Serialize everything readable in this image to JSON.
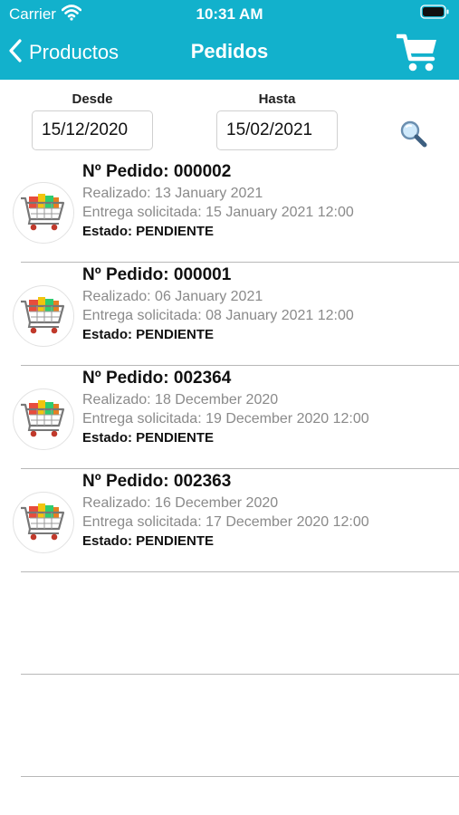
{
  "status_bar": {
    "carrier": "Carrier",
    "time": "10:31 AM"
  },
  "nav": {
    "back_label": "Productos",
    "title": "Pedidos"
  },
  "filters": {
    "from_label": "Desde",
    "from_value": "15/12/2020",
    "to_label": "Hasta",
    "to_value": "15/02/2021"
  },
  "orders": [
    {
      "number": "Nº Pedido: 000002",
      "placed": "Realizado: 13 January 2021",
      "delivery": "Entrega solicitada: 15 January 2021 12:00",
      "status": "Estado: PENDIENTE"
    },
    {
      "number": "Nº Pedido: 000001",
      "placed": "Realizado: 06 January 2021",
      "delivery": "Entrega solicitada: 08 January 2021 12:00",
      "status": "Estado: PENDIENTE"
    },
    {
      "number": "Nº Pedido: 002364",
      "placed": "Realizado: 18 December 2020",
      "delivery": "Entrega solicitada: 19 December 2020 12:00",
      "status": "Estado: PENDIENTE"
    },
    {
      "number": "Nº Pedido: 002363",
      "placed": "Realizado: 16 December 2020",
      "delivery": "Entrega solicitada: 17 December 2020 12:00",
      "status": "Estado: PENDIENTE"
    }
  ],
  "icons": {
    "back": "chevron-left-icon",
    "cart": "shopping-cart-icon",
    "search": "magnifier-icon",
    "order_thumb": "grocery-cart-icon"
  },
  "colors": {
    "header": "#12b1cc",
    "separator": "#b8b8b8"
  }
}
